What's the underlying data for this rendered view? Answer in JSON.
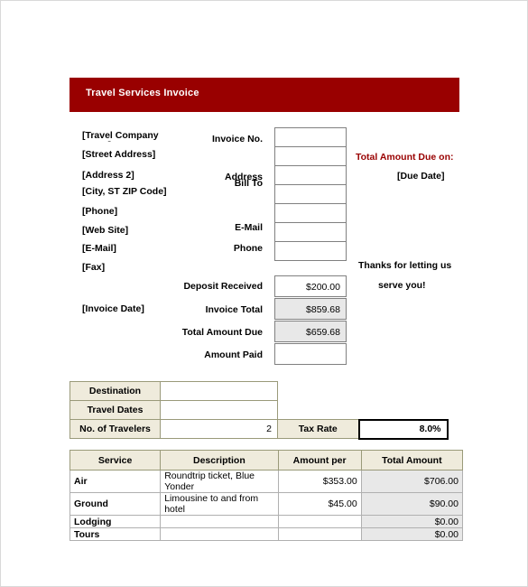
{
  "document": {
    "title": "Travel Services Invoice",
    "accent_color": "#990000",
    "label_fill_color": "#efebdc",
    "shaded_value_color": "#e8e8e8"
  },
  "sender": {
    "company": "[Travel Company Name]",
    "street": "[Street Address]",
    "address2": "[Address 2]",
    "city_state_zip": "[City, ST  ZIP Code]",
    "phone": "[Phone]",
    "web_site": "[Web Site]",
    "email": "[E-Mail]",
    "fax": "[Fax]",
    "invoice_date": "[Invoice Date]"
  },
  "fields": {
    "invoice_no": {
      "label": "Invoice No.",
      "value": ""
    },
    "bill_to": {
      "label": "Bill To",
      "value": ""
    },
    "address": {
      "label": "Address",
      "value": ""
    },
    "address_line_2": {
      "label": "",
      "value": ""
    },
    "address_line_3": {
      "label": "",
      "value": ""
    },
    "email": {
      "label": "E-Mail",
      "value": ""
    },
    "phone": {
      "label": "Phone",
      "value": ""
    }
  },
  "totals": {
    "deposit_received": {
      "label": "Deposit Received",
      "value": "$200.00"
    },
    "invoice_total": {
      "label": "Invoice Total",
      "value": "$859.68"
    },
    "total_amount_due": {
      "label": "Total Amount Due",
      "value": "$659.68"
    },
    "amount_paid": {
      "label": "Amount Paid",
      "value": ""
    }
  },
  "notices": {
    "due_on_label": "Total Amount Due on:",
    "due_date": "[Due Date]",
    "thanks_line_1": "Thanks for letting us",
    "thanks_line_2": "serve you!"
  },
  "trip": {
    "destination": {
      "label": "Destination",
      "value": ""
    },
    "travel_dates": {
      "label": "Travel Dates",
      "value": ""
    },
    "no_of_travelers": {
      "label": "No. of Travelers",
      "value": "2"
    },
    "tax_rate": {
      "label": "Tax Rate",
      "value": "8.0%"
    }
  },
  "services": {
    "columns": [
      "Service",
      "Description",
      "Amount per",
      "Total Amount"
    ],
    "rows": [
      {
        "service": "Air",
        "description": "Roundtrip ticket, Blue Yonder",
        "amount_per": "$353.00",
        "total_amount": "$706.00"
      },
      {
        "service": "Ground",
        "description": "Limousine to and from hotel",
        "amount_per": "$45.00",
        "total_amount": "$90.00"
      },
      {
        "service": "Lodging",
        "description": "",
        "amount_per": "",
        "total_amount": "$0.00"
      },
      {
        "service": "Tours",
        "description": "",
        "amount_per": "",
        "total_amount": "$0.00"
      }
    ]
  }
}
